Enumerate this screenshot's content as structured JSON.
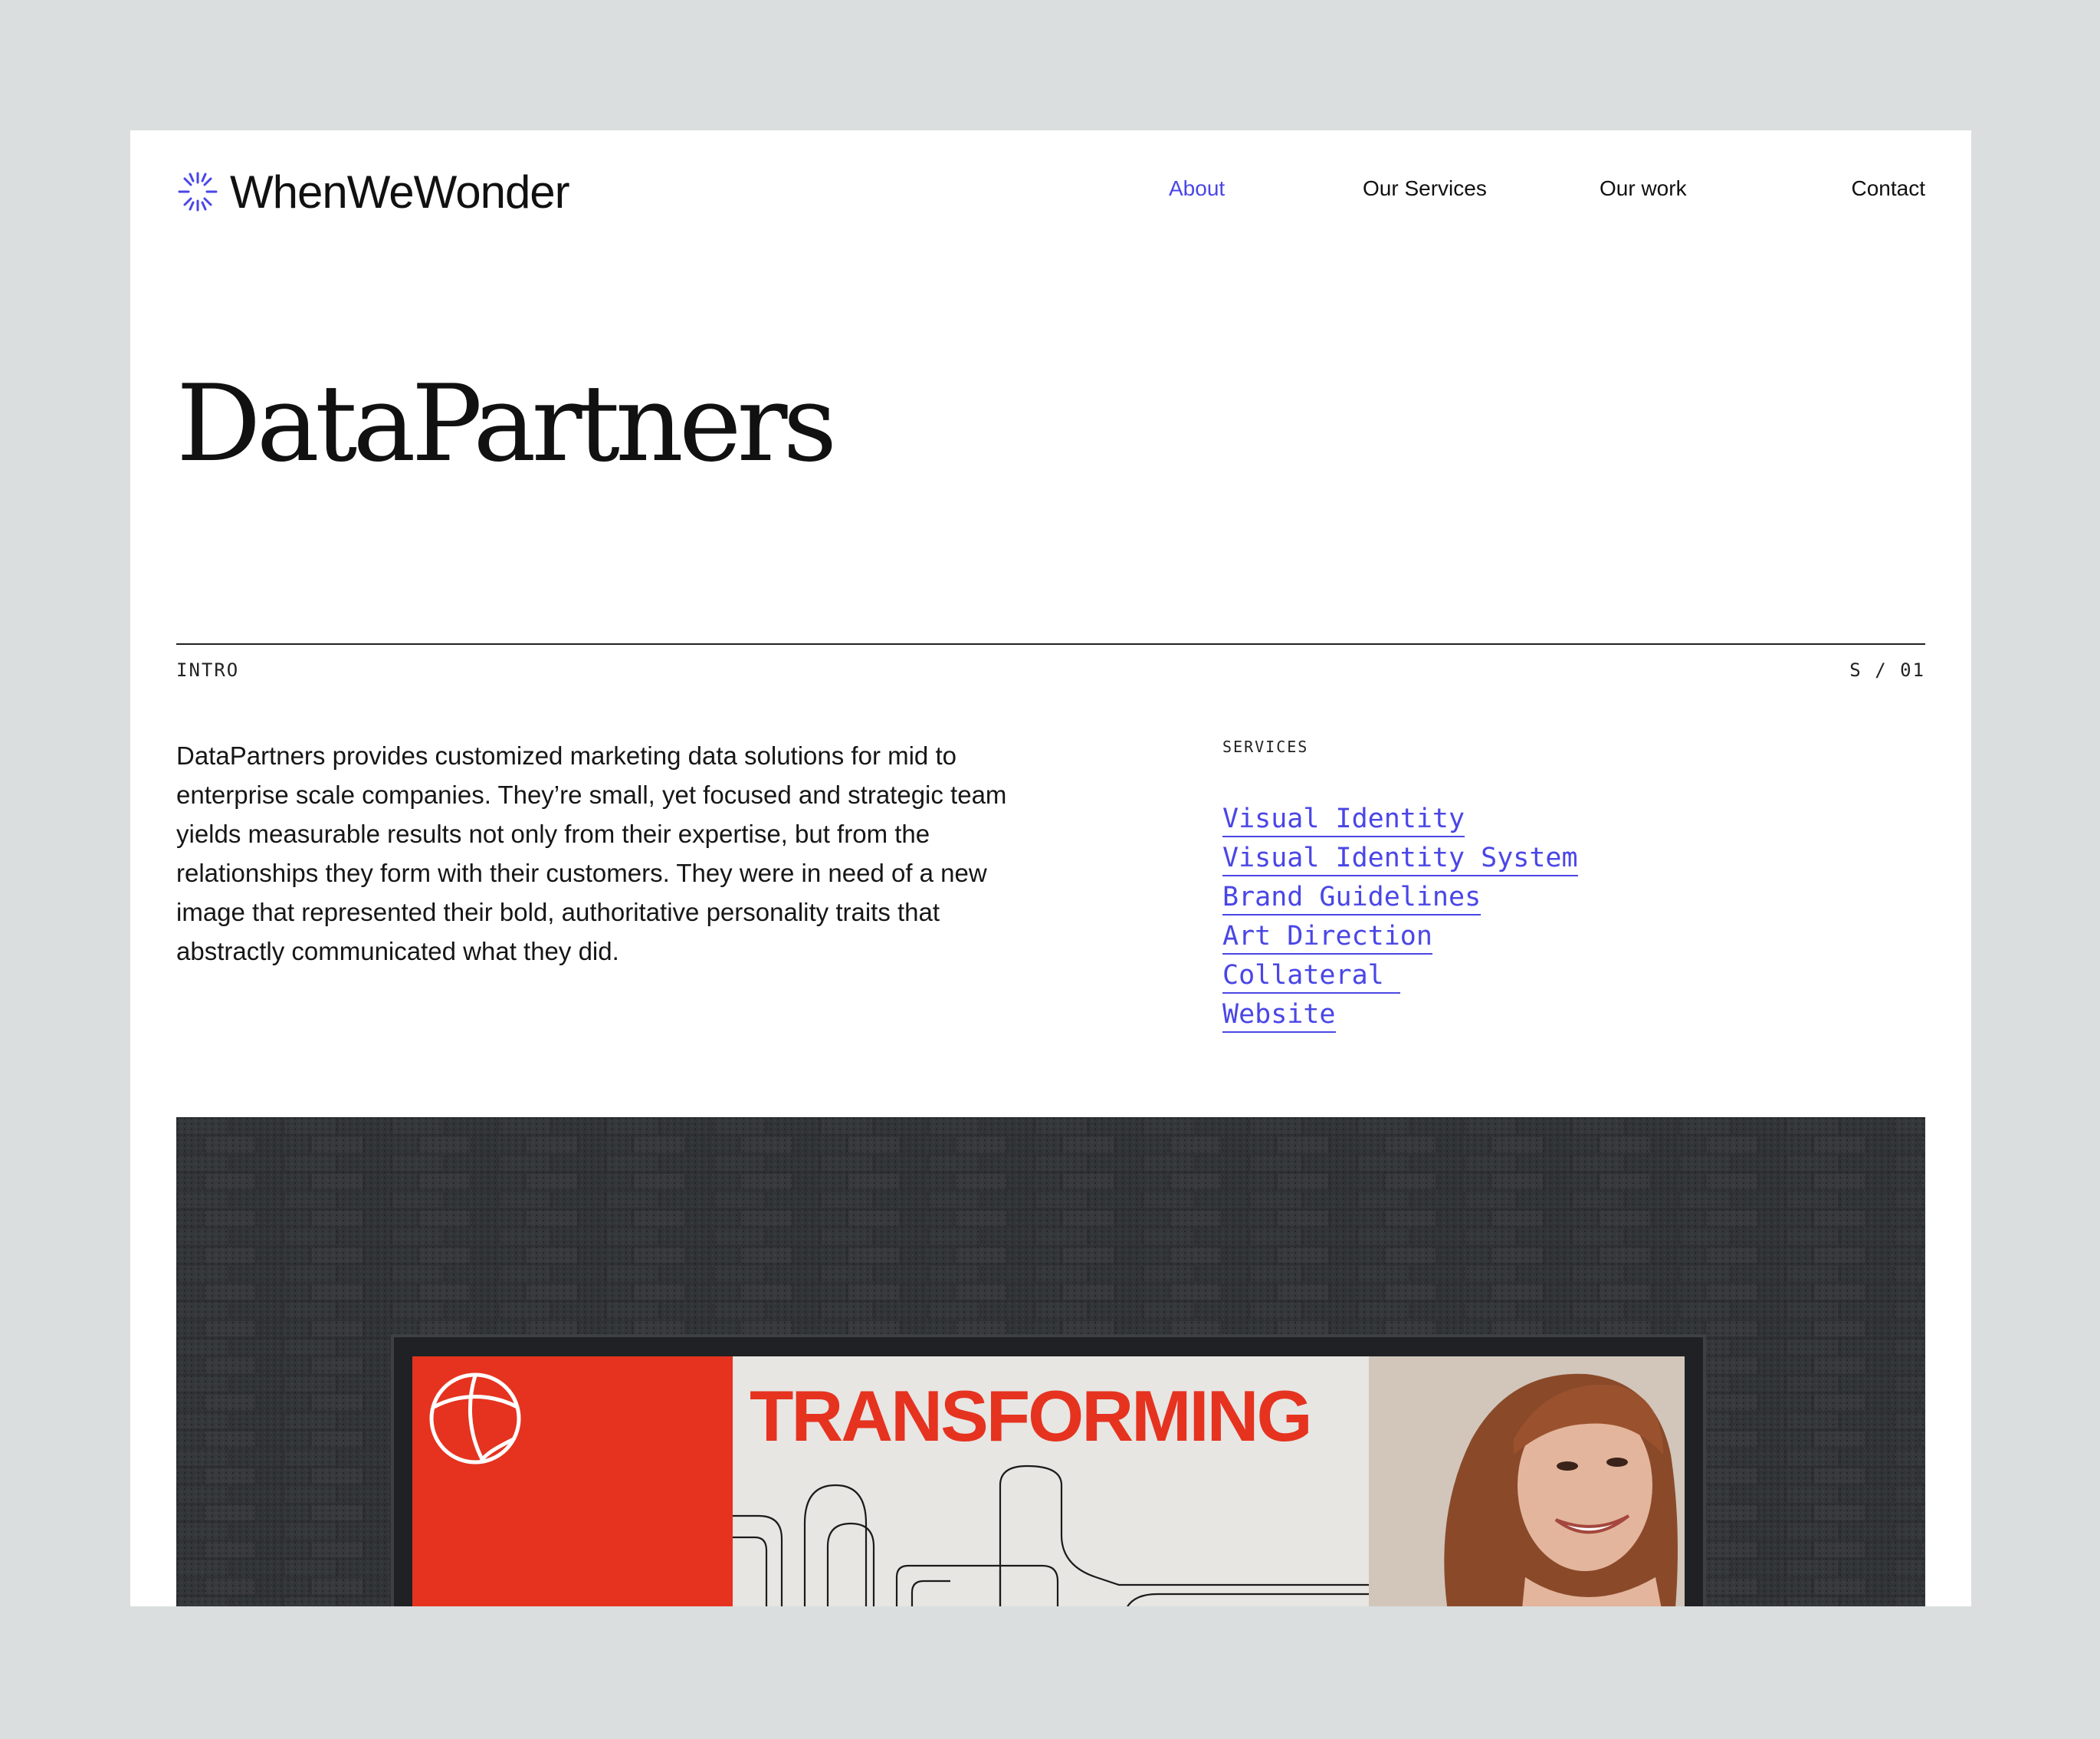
{
  "colors": {
    "accent": "#4a46e6",
    "poster_red": "#e53320",
    "wall": "#2e3033"
  },
  "header": {
    "logo_icon": "starburst-icon",
    "brand": "WhenWeWonder",
    "nav": [
      {
        "label": "About",
        "active": true
      },
      {
        "label": "Our Services",
        "active": false
      },
      {
        "label": "Our work",
        "active": false
      },
      {
        "label": "Contact",
        "active": false
      }
    ]
  },
  "project": {
    "title": "DataPartners"
  },
  "section": {
    "label": "INTRO",
    "index": "S / 01"
  },
  "intro": {
    "text": "DataPartners provides customized marketing data solutions for mid to enterprise scale companies. They’re small, yet focused and strategic team yields measurable results not only from their expertise, but from the relationships they form with their customers. They were in need of a new image that represented their bold, authoritative personality traits that abstractly communicated what they did."
  },
  "services": {
    "label": "SERVICES",
    "items": [
      "Visual Identity",
      "Visual Identity System",
      "Brand Guidelines",
      "Art Direction",
      "Collateral ",
      "Website"
    ]
  },
  "hero": {
    "poster_heading": "TRANSFORMING",
    "poster_logo_icon": "circle-mark-icon"
  }
}
